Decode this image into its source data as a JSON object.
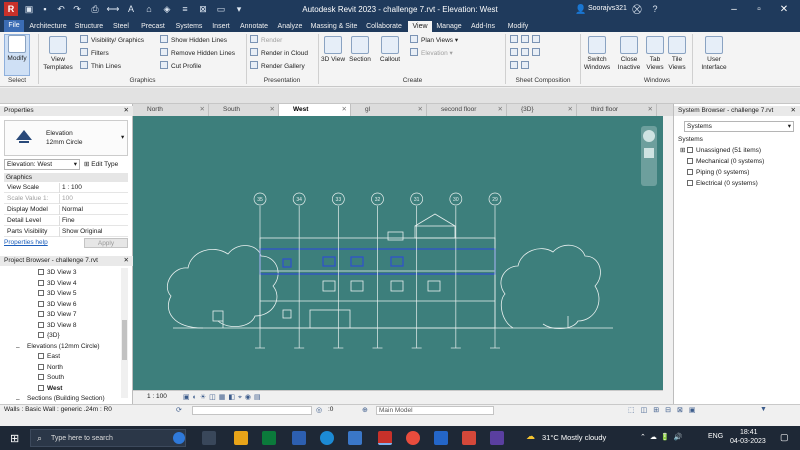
{
  "window": {
    "title": "Autodesk Revit 2023 - challenge 7.rvt - Elevation: West",
    "user": "Soorajvs321"
  },
  "menu_tabs": [
    "File",
    "Architecture",
    "Structure",
    "Steel",
    "Precast",
    "Systems",
    "Insert",
    "Annotate",
    "Analyze",
    "Massing & Site",
    "Collaborate",
    "View",
    "Manage",
    "Add-Ins",
    "Modify"
  ],
  "active_tab": "View",
  "ribbon": {
    "modify": "Modify",
    "select": "Select",
    "view_templates": "View Templates",
    "visibility_graphics": "Visibility/ Graphics",
    "filters": "Filters",
    "thin_lines": "Thin  Lines",
    "show_hidden_lines": "Show  Hidden Lines",
    "remove_hidden_lines": "Remove  Hidden Lines",
    "cut_profile": "Cut  Profile",
    "graphics_label": "Graphics",
    "render": "Render",
    "render_in_cloud": "Render  in Cloud",
    "render_gallery": "Render  Gallery",
    "presentation_label": "Presentation",
    "view_3d": "3D View",
    "section": "Section",
    "callout": "Callout",
    "plan_views": "Plan  Views",
    "elevation": "Elevation",
    "create_label": "Create",
    "sheet_composition_label": "Sheet Composition",
    "switch_windows": "Switch Windows",
    "close_inactive": "Close Inactive",
    "tab_views": "Tab Views",
    "tile_views": "Tile Views",
    "windows_label": "Windows",
    "user_interface": "User Interface"
  },
  "view_tabs": [
    {
      "label": "North",
      "active": false
    },
    {
      "label": "South",
      "active": false
    },
    {
      "label": "West",
      "active": true
    },
    {
      "label": "gl",
      "active": false
    },
    {
      "label": "second floor",
      "active": false
    },
    {
      "label": "{3D}",
      "active": false
    },
    {
      "label": "third floor",
      "active": false
    }
  ],
  "properties": {
    "header": "Properties",
    "family": "Elevation",
    "type": "12mm Circle",
    "selector": "Elevation: West",
    "edit_type": "Edit Type",
    "group": "Graphics",
    "rows": [
      {
        "k": "View Scale",
        "v": "1 : 100",
        "disabled": false
      },
      {
        "k": "Scale Value  1:",
        "v": "100",
        "disabled": true
      },
      {
        "k": "Display Model",
        "v": "Normal",
        "disabled": false
      },
      {
        "k": "Detail Level",
        "v": "Fine",
        "disabled": false
      },
      {
        "k": "Parts Visibility",
        "v": "Show Original",
        "disabled": false
      }
    ],
    "help": "Properties help",
    "apply": "Apply"
  },
  "project_browser": {
    "header": "Project Browser - challenge 7.rvt",
    "items": [
      {
        "label": "3D View 3",
        "level": 3,
        "bold": false
      },
      {
        "label": "3D View 4",
        "level": 3,
        "bold": false
      },
      {
        "label": "3D View 5",
        "level": 3,
        "bold": false
      },
      {
        "label": "3D View 6",
        "level": 3,
        "bold": false
      },
      {
        "label": "3D View 7",
        "level": 3,
        "bold": false
      },
      {
        "label": "3D View 8",
        "level": 3,
        "bold": false
      },
      {
        "label": "{3D}",
        "level": 3,
        "bold": false
      },
      {
        "label": "Elevations (12mm Circle)",
        "level": 2,
        "bold": false
      },
      {
        "label": "East",
        "level": 3,
        "bold": false
      },
      {
        "label": "North",
        "level": 3,
        "bold": false
      },
      {
        "label": "South",
        "level": 3,
        "bold": false
      },
      {
        "label": "West",
        "level": 3,
        "bold": true
      },
      {
        "label": "Sections (Building Section)",
        "level": 2,
        "bold": false
      }
    ]
  },
  "system_browser": {
    "header": "System Browser - challenge 7.rvt",
    "dropdown": "Systems",
    "col": "Systems",
    "items": [
      "Unassigned (51 items)",
      "Mechanical (0 systems)",
      "Piping (0 systems)",
      "Electrical (0 systems)"
    ]
  },
  "grids": [
    "35",
    "34",
    "33",
    "32",
    "31",
    "30",
    "29"
  ],
  "view_control": {
    "scale": "1 : 100"
  },
  "status": {
    "text": "Walls : Basic Wall : generic .24m : R0",
    "zero": ":0",
    "model": "Main Model"
  },
  "taskbar": {
    "search": "Type here to search",
    "weather": "31°C  Mostly cloudy",
    "lang": "ENG",
    "time": "18:41",
    "date": "04-03-2023"
  },
  "colors": {
    "title": "#1f3a5c",
    "canvas": "#3d7f7c",
    "selection": "#2f4fd0",
    "accent": "#3b6cb4"
  }
}
